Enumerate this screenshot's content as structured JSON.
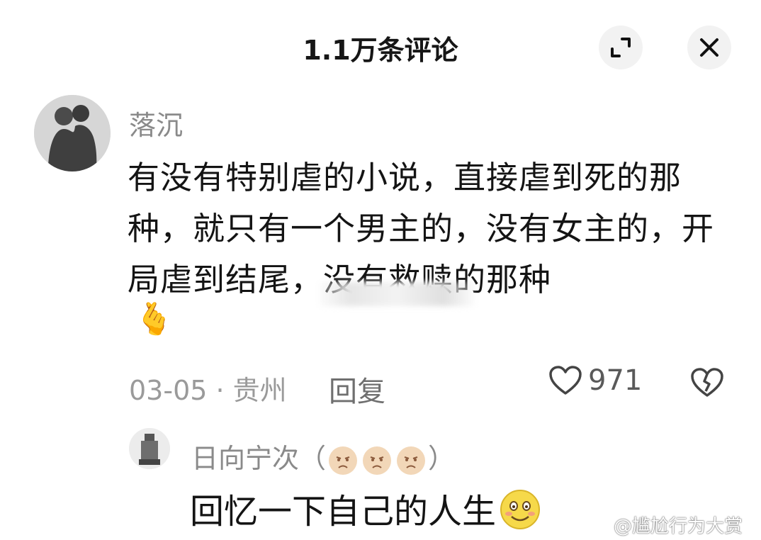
{
  "header": {
    "title": "1.1万条评论"
  },
  "comment": {
    "username": "落沉",
    "text": "有没有特别虐的小说，直接虐到死的那种，就只有一个男主的，没有女主的，开局虐到结尾，没有救赎的那种",
    "meta": "03-05 · 贵州",
    "reply_label": "回复",
    "like_count": "971",
    "emoji": "🫰"
  },
  "reply": {
    "username": "日向宁次（",
    "username_close": "）",
    "text": "回忆一下自己的人生",
    "emoji": "😊"
  },
  "watermark": {
    "text": "@尴尬行为大赏",
    "icon": "weibo-icon"
  },
  "colors": {
    "text": "#141414",
    "muted": "#8a8a8a",
    "background": "#ffffff"
  }
}
